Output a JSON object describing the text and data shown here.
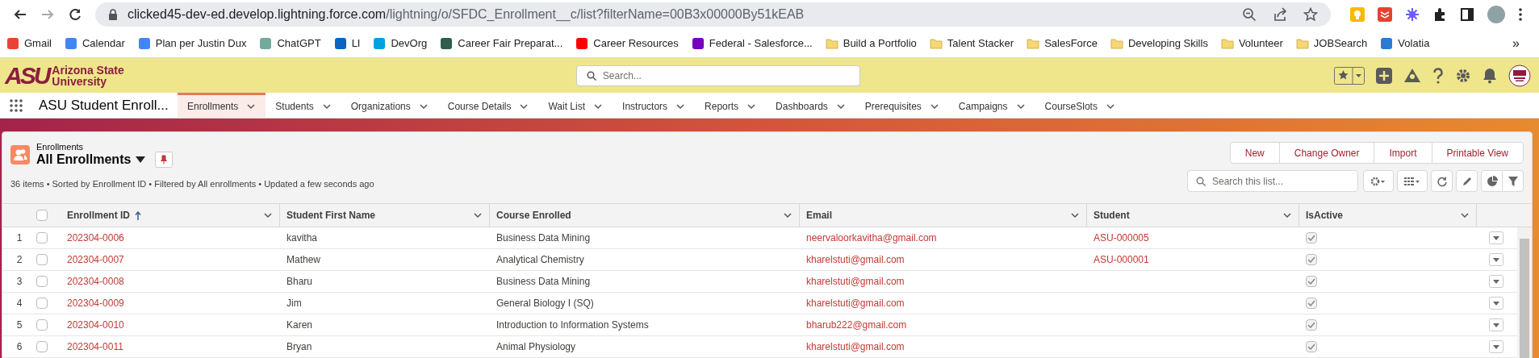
{
  "browser": {
    "url_host": "clicked45-dev-ed.develop.lightning.force.com",
    "url_path": "/lightning/o/SFDC_Enrollment__c/list?filterName=00B3x00000By51kEAB",
    "bookmarks": [
      {
        "label": "Gmail",
        "kind": "site",
        "color": "#ea4335"
      },
      {
        "label": "Calendar",
        "kind": "site",
        "color": "#4285f4"
      },
      {
        "label": "Plan per Justin Dux",
        "kind": "site",
        "color": "#4285f4"
      },
      {
        "label": "ChatGPT",
        "kind": "site",
        "color": "#74aa9c"
      },
      {
        "label": "LI",
        "kind": "site",
        "color": "#0a66c2"
      },
      {
        "label": "DevOrg",
        "kind": "site",
        "color": "#00a1e0"
      },
      {
        "label": "Career Fair Preparat...",
        "kind": "site",
        "color": "#2e5e4e"
      },
      {
        "label": "Career Resources",
        "kind": "site",
        "color": "#ff0000"
      },
      {
        "label": "Federal - Salesforce...",
        "kind": "site",
        "color": "#7500c0"
      },
      {
        "label": "Build a Portfolio",
        "kind": "folder"
      },
      {
        "label": "Talent Stacker",
        "kind": "folder"
      },
      {
        "label": "SalesForce",
        "kind": "folder"
      },
      {
        "label": "Developing Skills",
        "kind": "folder"
      },
      {
        "label": "Volunteer",
        "kind": "folder"
      },
      {
        "label": "JOBSearch",
        "kind": "folder"
      },
      {
        "label": "Volatia",
        "kind": "site",
        "color": "#2a7bd3"
      }
    ],
    "more": "»"
  },
  "header": {
    "logo_mark": "ASU",
    "logo_line1": "Arizona State",
    "logo_line2": "University",
    "search_placeholder": "Search..."
  },
  "nav": {
    "app_name": "ASU Student Enroll...",
    "tabs": [
      {
        "label": "Enrollments",
        "selected": true
      },
      {
        "label": "Students",
        "selected": false
      },
      {
        "label": "Organizations",
        "selected": false
      },
      {
        "label": "Course Details",
        "selected": false
      },
      {
        "label": "Wait List",
        "selected": false
      },
      {
        "label": "Instructors",
        "selected": false
      },
      {
        "label": "Reports",
        "selected": false
      },
      {
        "label": "Dashboards",
        "selected": false
      },
      {
        "label": "Prerequisites",
        "selected": false
      },
      {
        "label": "Campaigns",
        "selected": false
      },
      {
        "label": "CourseSlots",
        "selected": false
      }
    ]
  },
  "list": {
    "object_label": "Enrollments",
    "view_name": "All Enrollments",
    "summary": "36 items • Sorted by Enrollment ID • Filtered by All enrollments • Updated a few seconds ago",
    "actions": [
      "New",
      "Change Owner",
      "Import",
      "Printable View"
    ],
    "search_placeholder": "Search this list...",
    "all_selected": false,
    "columns": [
      {
        "label": "Enrollment ID",
        "sorted": true
      },
      {
        "label": "Student First Name",
        "sorted": false
      },
      {
        "label": "Course Enrolled",
        "sorted": false
      },
      {
        "label": "Email",
        "sorted": false
      },
      {
        "label": "Student",
        "sorted": false
      },
      {
        "label": "IsActive",
        "sorted": false
      }
    ],
    "rows": [
      {
        "number": "1",
        "enrollment_id": "202304-0006",
        "first_name": "kavitha",
        "course": "Business Data Mining",
        "email": "neervaloorkavitha@gmail.com",
        "student": "ASU-000005",
        "is_active": true,
        "selected": false
      },
      {
        "number": "2",
        "enrollment_id": "202304-0007",
        "first_name": "Mathew",
        "course": "Analytical Chemistry",
        "email": "kharelstuti@gmail.com",
        "student": "ASU-000001",
        "is_active": true,
        "selected": false
      },
      {
        "number": "3",
        "enrollment_id": "202304-0008",
        "first_name": "Bharu",
        "course": "Business Data Mining",
        "email": "kharelstuti@gmail.com",
        "is_active": true,
        "selected": false
      },
      {
        "number": "4",
        "enrollment_id": "202304-0009",
        "first_name": "Jim",
        "course": "General Biology I (SQ)",
        "email": "kharelstuti@gmail.com",
        "is_active": true,
        "selected": false
      },
      {
        "number": "5",
        "enrollment_id": "202304-0010",
        "first_name": "Karen",
        "course": "Introduction to Information Systems",
        "email": "bharub222@gmail.com",
        "is_active": true,
        "selected": false
      },
      {
        "number": "6",
        "enrollment_id": "202304-0011",
        "first_name": "Bryan",
        "course": "Animal Physiology",
        "email": "kharelstuti@gmail.com",
        "is_active": true,
        "selected": false
      }
    ]
  }
}
